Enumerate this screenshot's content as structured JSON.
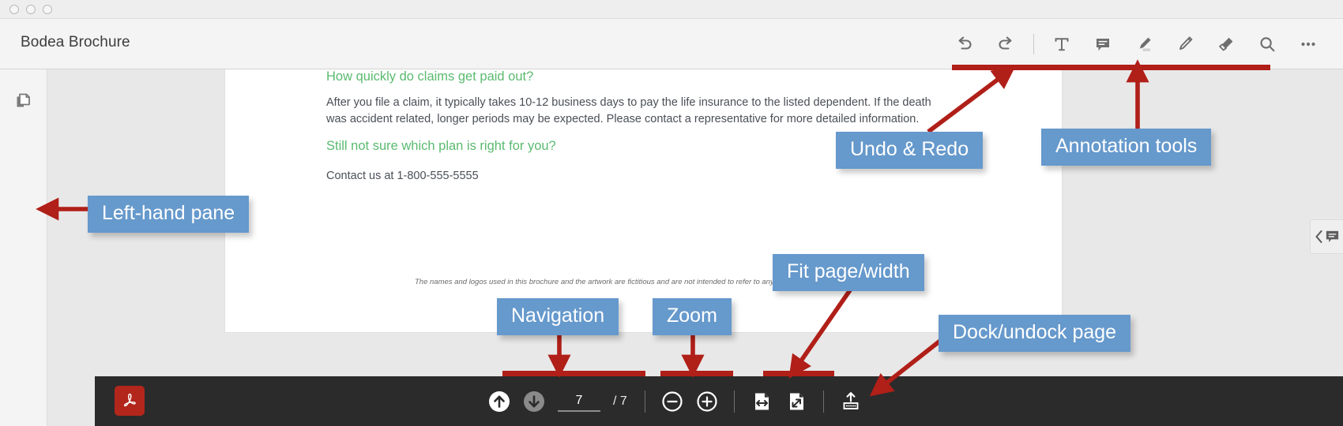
{
  "window": {
    "traffic_lights": [
      "close",
      "minimize",
      "maximize"
    ]
  },
  "header": {
    "doc_title": "Bodea Brochure",
    "tools": [
      {
        "name": "undo-button",
        "icon": "undo-icon",
        "label": "Undo"
      },
      {
        "name": "redo-button",
        "icon": "redo-icon",
        "label": "Redo"
      },
      {
        "name": "add-text-button",
        "icon": "text-icon",
        "label": "Add text"
      },
      {
        "name": "add-comment-button",
        "icon": "comment-icon",
        "label": "Add comment"
      },
      {
        "name": "highlight-button",
        "icon": "highlighter-icon",
        "label": "Highlight"
      },
      {
        "name": "draw-button",
        "icon": "pencil-icon",
        "label": "Draw"
      },
      {
        "name": "erase-button",
        "icon": "eraser-icon",
        "label": "Erase"
      },
      {
        "name": "search-button",
        "icon": "search-icon",
        "label": "Search"
      },
      {
        "name": "more-button",
        "icon": "more-icon",
        "label": "More"
      }
    ]
  },
  "left_rail": {
    "thumbnails_label": "Page thumbnails",
    "icon": "pages-icon"
  },
  "right_panel": {
    "comment_toggle_label": "Comments",
    "chevron_icon": "chevron-left-icon",
    "bubble_icon": "comment-icon"
  },
  "document": {
    "heading_1": "How quickly do claims get paid out?",
    "paragraph_1": "After you file a claim, it typically takes 10-12 business days to pay the life insurance to the listed dependent. If the death was accident related, longer periods may be expected. Please contact a representative for more detailed information.",
    "heading_2": "Still not sure which plan is right for you?",
    "paragraph_2": "Contact us at 1-800-555-5555",
    "disclaimer": "The names and logos used in this brochure and the artwork are fictitious and are not intended to refer to any actual organization, products or services."
  },
  "bottom_bar": {
    "app_icon": "acrobat-icon",
    "previous_page_label": "Previous page",
    "next_page_label": "Next page",
    "current_page": "7",
    "page_total": "/ 7",
    "zoom_out_label": "Zoom out",
    "zoom_in_label": "Zoom in",
    "fit_width_label": "Fit width",
    "fit_page_label": "Fit page",
    "dock_label": "Dock / undock page controls"
  },
  "annotations": {
    "callouts": [
      {
        "id": "left-hand-pane",
        "text": "Left-hand pane"
      },
      {
        "id": "undo-redo",
        "text": "Undo & Redo"
      },
      {
        "id": "annotation-tools",
        "text": "Annotation tools"
      },
      {
        "id": "fit-page-width",
        "text": "Fit page/width"
      },
      {
        "id": "dock-undock",
        "text": "Dock/undock page"
      },
      {
        "id": "navigation",
        "text": "Navigation"
      },
      {
        "id": "zoom",
        "text": "Zoom"
      }
    ]
  },
  "colors": {
    "callout_fill": "#6699cc",
    "annotation_red": "#b01f18",
    "heading_green": "#5aba6f",
    "acrobat_red": "#b3261b",
    "bottom_bar": "#2b2b2b"
  }
}
